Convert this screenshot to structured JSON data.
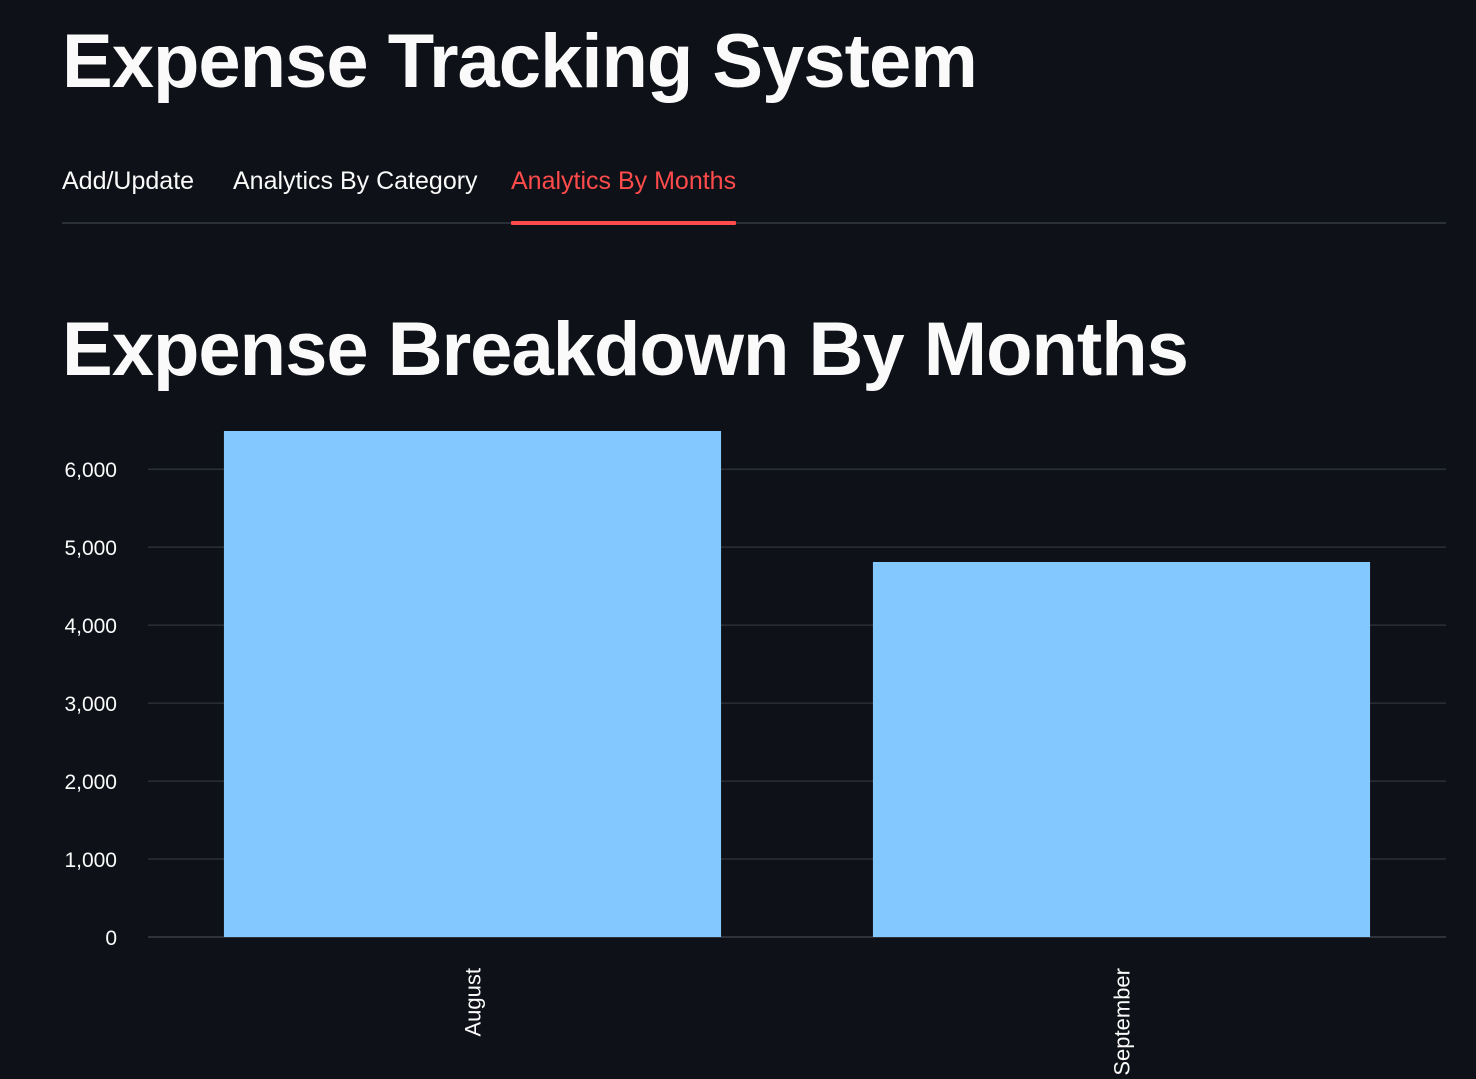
{
  "app": {
    "title": "Expense Tracking System"
  },
  "tabs": [
    {
      "label": "Add/Update",
      "active": false
    },
    {
      "label": "Analytics By Category",
      "active": false
    },
    {
      "label": "Analytics By Months",
      "active": true
    }
  ],
  "section": {
    "title": "Expense Breakdown By Months"
  },
  "colors": {
    "background": "#0e1117",
    "text": "#fafafa",
    "accent": "#ff4b4b",
    "bar": "#83c9ff",
    "grid": "#2b2f38"
  },
  "chart_data": {
    "type": "bar",
    "categories": [
      "August",
      "September"
    ],
    "values": [
      6490,
      4810
    ],
    "title": "",
    "xlabel": "",
    "ylabel": "",
    "ylim": [
      0,
      6490
    ],
    "yticks": [
      0,
      1000,
      2000,
      3000,
      4000,
      5000,
      6000
    ],
    "ytick_labels": [
      "0",
      "1,000",
      "2,000",
      "3,000",
      "4,000",
      "5,000",
      "6,000"
    ],
    "grid": true,
    "legend": "none"
  }
}
